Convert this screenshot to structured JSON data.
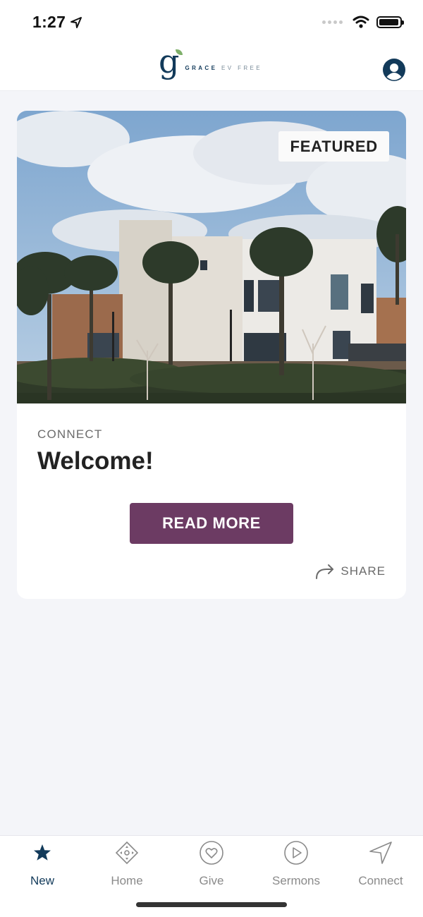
{
  "status_bar": {
    "time": "1:27"
  },
  "header": {
    "logo_letter": "g",
    "logo_word_bold": "GRACE",
    "logo_word_light": "EV FREE"
  },
  "card": {
    "badge": "FEATURED",
    "category": "CONNECT",
    "title": "Welcome!",
    "button_label": "READ MORE",
    "share_label": "SHARE"
  },
  "tabs": [
    {
      "label": "New",
      "icon": "star-icon",
      "active": true
    },
    {
      "label": "Home",
      "icon": "diamond-icon",
      "active": false
    },
    {
      "label": "Give",
      "icon": "heart-icon",
      "active": false
    },
    {
      "label": "Sermons",
      "icon": "play-icon",
      "active": false
    },
    {
      "label": "Connect",
      "icon": "navigation-arrow-icon",
      "active": false
    }
  ],
  "colors": {
    "accent": "#6c3b63",
    "brand": "#123a5a",
    "inactive": "#8a8a8a"
  }
}
